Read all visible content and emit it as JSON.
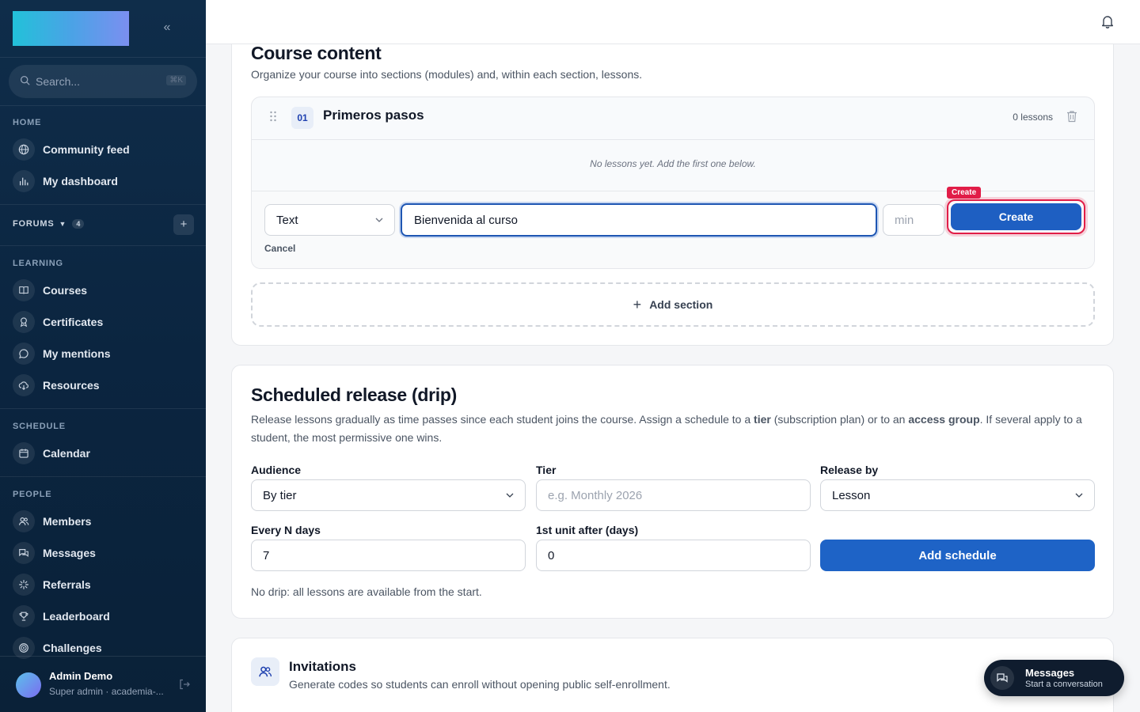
{
  "sidebar": {
    "search_placeholder": "Search...",
    "search_shortcut": "⌘K",
    "sections": {
      "home": "HOME",
      "forums": "FORUMS",
      "forums_count": "4",
      "learning": "LEARNING",
      "schedule": "SCHEDULE",
      "people": "PEOPLE"
    },
    "items": {
      "community_feed": "Community feed",
      "my_dashboard": "My dashboard",
      "courses": "Courses",
      "certificates": "Certificates",
      "my_mentions": "My mentions",
      "resources": "Resources",
      "calendar": "Calendar",
      "members": "Members",
      "messages": "Messages",
      "referrals": "Referrals",
      "leaderboard": "Leaderboard",
      "challenges": "Challenges"
    },
    "user": {
      "name": "Admin Demo",
      "role": "Super admin · academia-..."
    }
  },
  "course_content": {
    "title": "Course content",
    "description": "Organize your course into sections (modules) and, within each section, lessons.",
    "section": {
      "number": "01",
      "title": "Primeros pasos",
      "lesson_count": "0 lessons",
      "empty_text": "No lessons yet. Add the first one below."
    },
    "lesson_form": {
      "type_value": "Text",
      "title_value": "Bienvenida al curso",
      "duration_placeholder": "min",
      "create_label": "Create",
      "create_tag": "Create",
      "cancel_label": "Cancel"
    },
    "add_section_label": "Add section"
  },
  "drip": {
    "title": "Scheduled release (drip)",
    "desc_part1": "Release lessons gradually as time passes since each student joins the course. Assign a schedule to a ",
    "desc_bold1": "tier",
    "desc_part2": " (subscription plan) or to an ",
    "desc_bold2": "access group",
    "desc_part3": ". If several apply to a student, the most permissive one wins.",
    "audience_label": "Audience",
    "audience_value": "By tier",
    "tier_label": "Tier",
    "tier_placeholder": "e.g. Monthly 2026",
    "release_label": "Release by",
    "release_value": "Lesson",
    "every_label": "Every N days",
    "every_value": "7",
    "first_label": "1st unit after (days)",
    "first_value": "0",
    "add_schedule_label": "Add schedule",
    "note": "No drip: all lessons are available from the start."
  },
  "invitations": {
    "title": "Invitations",
    "description": "Generate codes so students can enroll without opening public self-enrollment."
  },
  "messages_widget": {
    "title": "Messages",
    "subtitle": "Start a conversation"
  }
}
